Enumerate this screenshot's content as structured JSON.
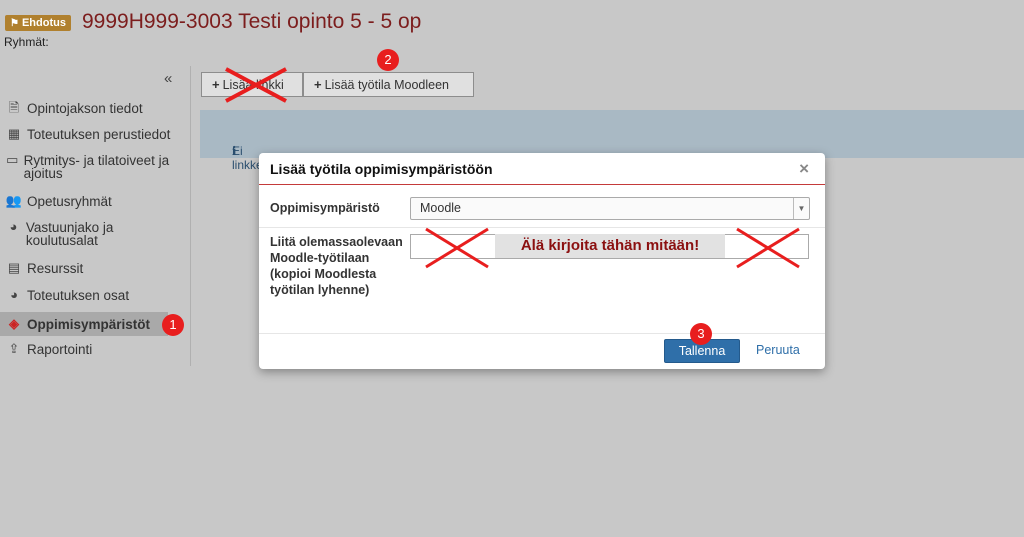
{
  "header": {
    "badge": "Ehdotus",
    "title": "9999H999-3003 Testi opinto 5 - 5 op",
    "groups_label": "Ryhmät:"
  },
  "sidebar": {
    "collapse": "«",
    "items": [
      {
        "label": "Opintojakson tiedot",
        "icon": "document-icon"
      },
      {
        "label": "Toteutuksen perustiedot",
        "icon": "grid-icon"
      },
      {
        "label": "Rytmitys- ja tilatoiveet ja ajoitus",
        "icon": "calendar-icon"
      },
      {
        "label": "Opetusryhmät",
        "icon": "users-icon"
      },
      {
        "label": "Vastuunjako ja koulutusalat",
        "icon": "pie-chart-icon"
      },
      {
        "label": "Resurssit",
        "icon": "calendar-grid-icon"
      },
      {
        "label": "Toteutuksen osat",
        "icon": "pie-chart-icon"
      },
      {
        "label": "Oppimisympäristöt",
        "icon": "cube-icon"
      },
      {
        "label": "Raportointi",
        "icon": "upload-icon"
      }
    ]
  },
  "toolbar": {
    "add_link": "Lisää linkki",
    "add_moodle": "Lisää työtila Moodleen"
  },
  "info": {
    "text": "Ei linkkejä"
  },
  "modal": {
    "title": "Lisää työtila oppimisympäristöön",
    "close": "×",
    "env_label": "Oppimisympäristö",
    "env_value": "Moodle",
    "attach_label_lines": [
      "Liitä olemassaolevaan",
      "Moodle-työtilaan",
      "(kopioi Moodlesta",
      "työtilan lyhenne)"
    ],
    "input_value": "",
    "warning": "Älä kirjoita tähän mitään!",
    "save": "Tallenna",
    "cancel": "Peruuta"
  },
  "annotations": {
    "step1": "1",
    "step2": "2",
    "step3": "3"
  },
  "colors": {
    "title": "#7c1d1d",
    "badge": "#b0802e",
    "primary": "#2f6fa9",
    "marker": "#e81e1e"
  }
}
